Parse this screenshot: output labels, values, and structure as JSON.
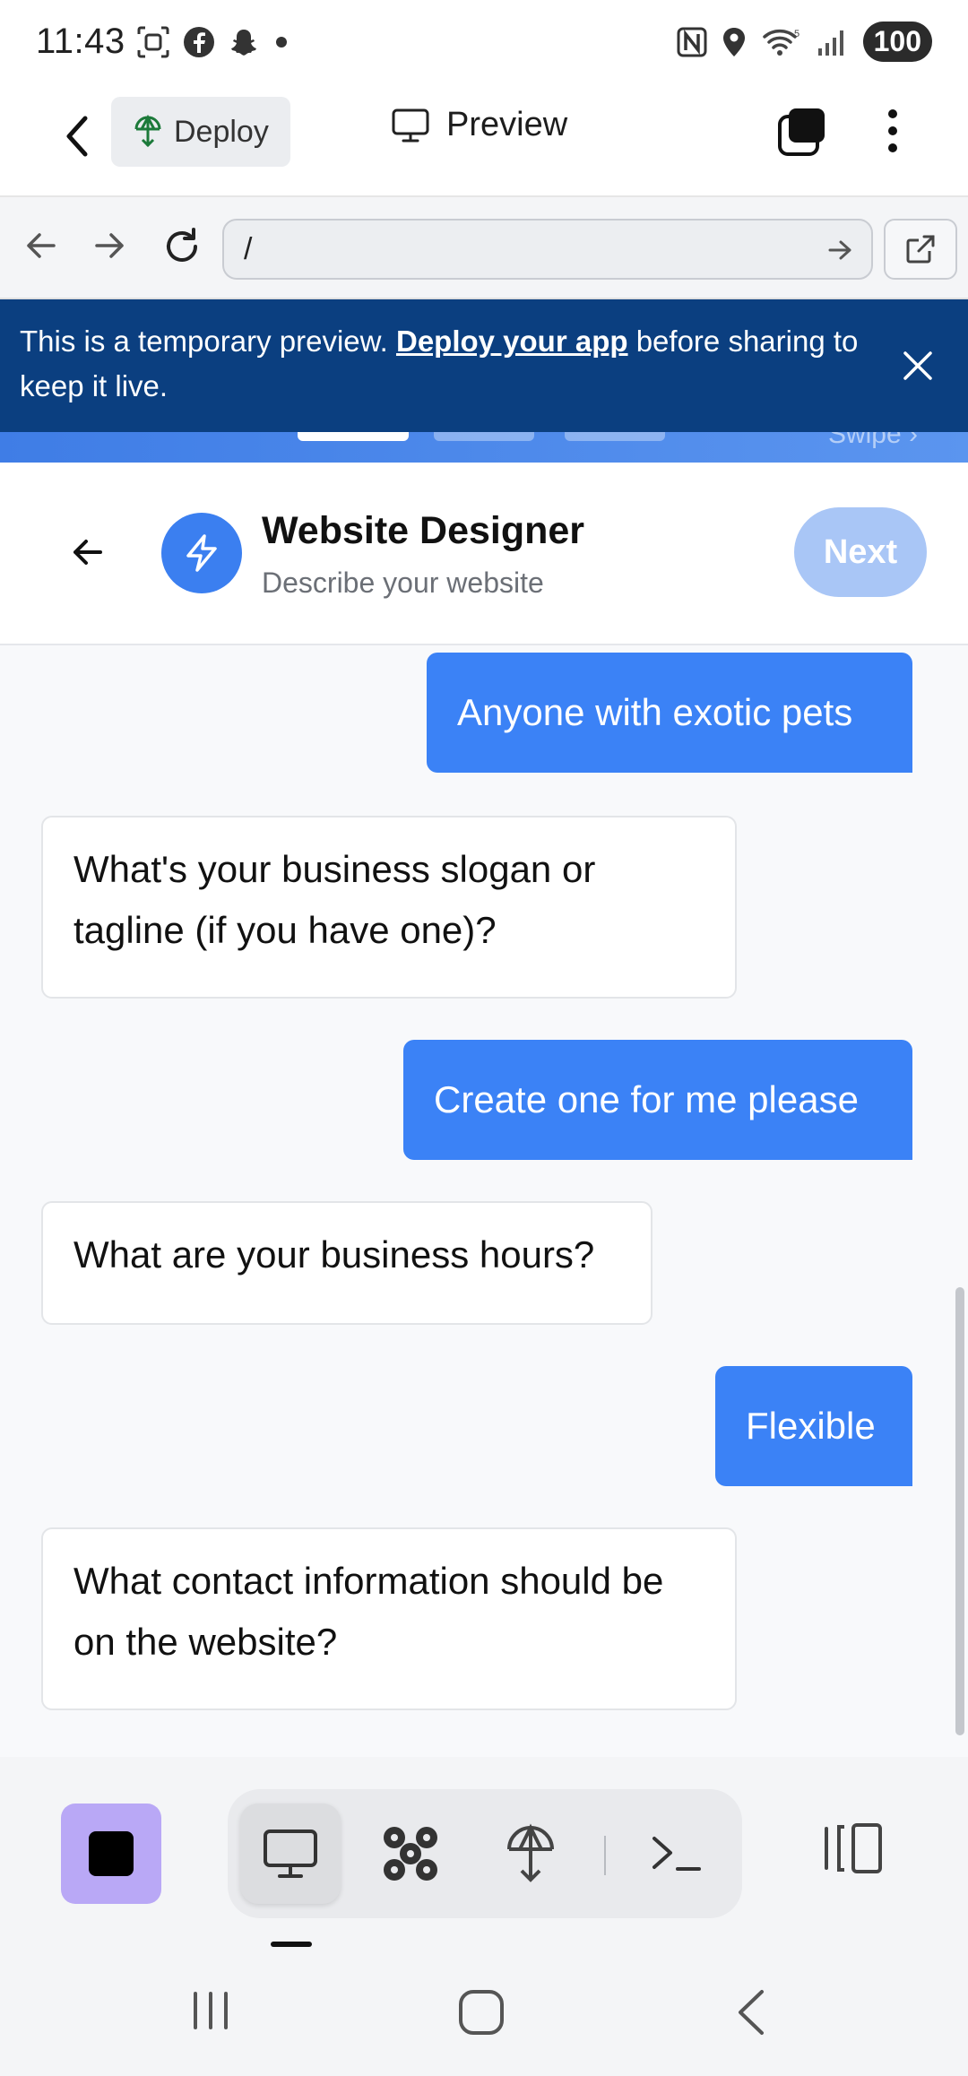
{
  "status_bar": {
    "time": "11:43",
    "battery": "100",
    "wifi_label": "5"
  },
  "top_bar": {
    "deploy_label": "Deploy",
    "preview_label": "Preview"
  },
  "url_bar": {
    "value": "/"
  },
  "banner": {
    "text_before": "This is a temporary preview. ",
    "link_text": "Deploy your app",
    "text_after": " before sharing to keep it live.",
    "swipe_text": "Swipe"
  },
  "app_header": {
    "title": "Website Designer",
    "subtitle": "Describe your website",
    "next_label": "Next"
  },
  "chat": {
    "messages": [
      {
        "role": "user",
        "text": "Anyone with exotic pets"
      },
      {
        "role": "bot",
        "text": "What's your business slogan or tagline (if you have one)?"
      },
      {
        "role": "user",
        "text": "Create one for me please"
      },
      {
        "role": "bot",
        "text": "What are your business hours?"
      },
      {
        "role": "user",
        "text": "Flexible"
      },
      {
        "role": "bot",
        "text": "What contact information should be on the website?"
      }
    ]
  },
  "colors": {
    "accent": "#3b82f6",
    "banner_bg": "#0b3f80",
    "next_disabled": "#a9c6f6",
    "stop_bg": "#b9a8f6"
  },
  "icons": {
    "status_left": [
      "screenshot-icon",
      "facebook-icon",
      "snapchat-icon",
      "dot-icon"
    ],
    "status_right": [
      "nfc-icon",
      "location-icon",
      "wifi-icon",
      "signal-icon"
    ],
    "bottom_tools": [
      "preview-monitor-icon",
      "agent-icon",
      "deploy-icon",
      "shell-icon"
    ]
  }
}
